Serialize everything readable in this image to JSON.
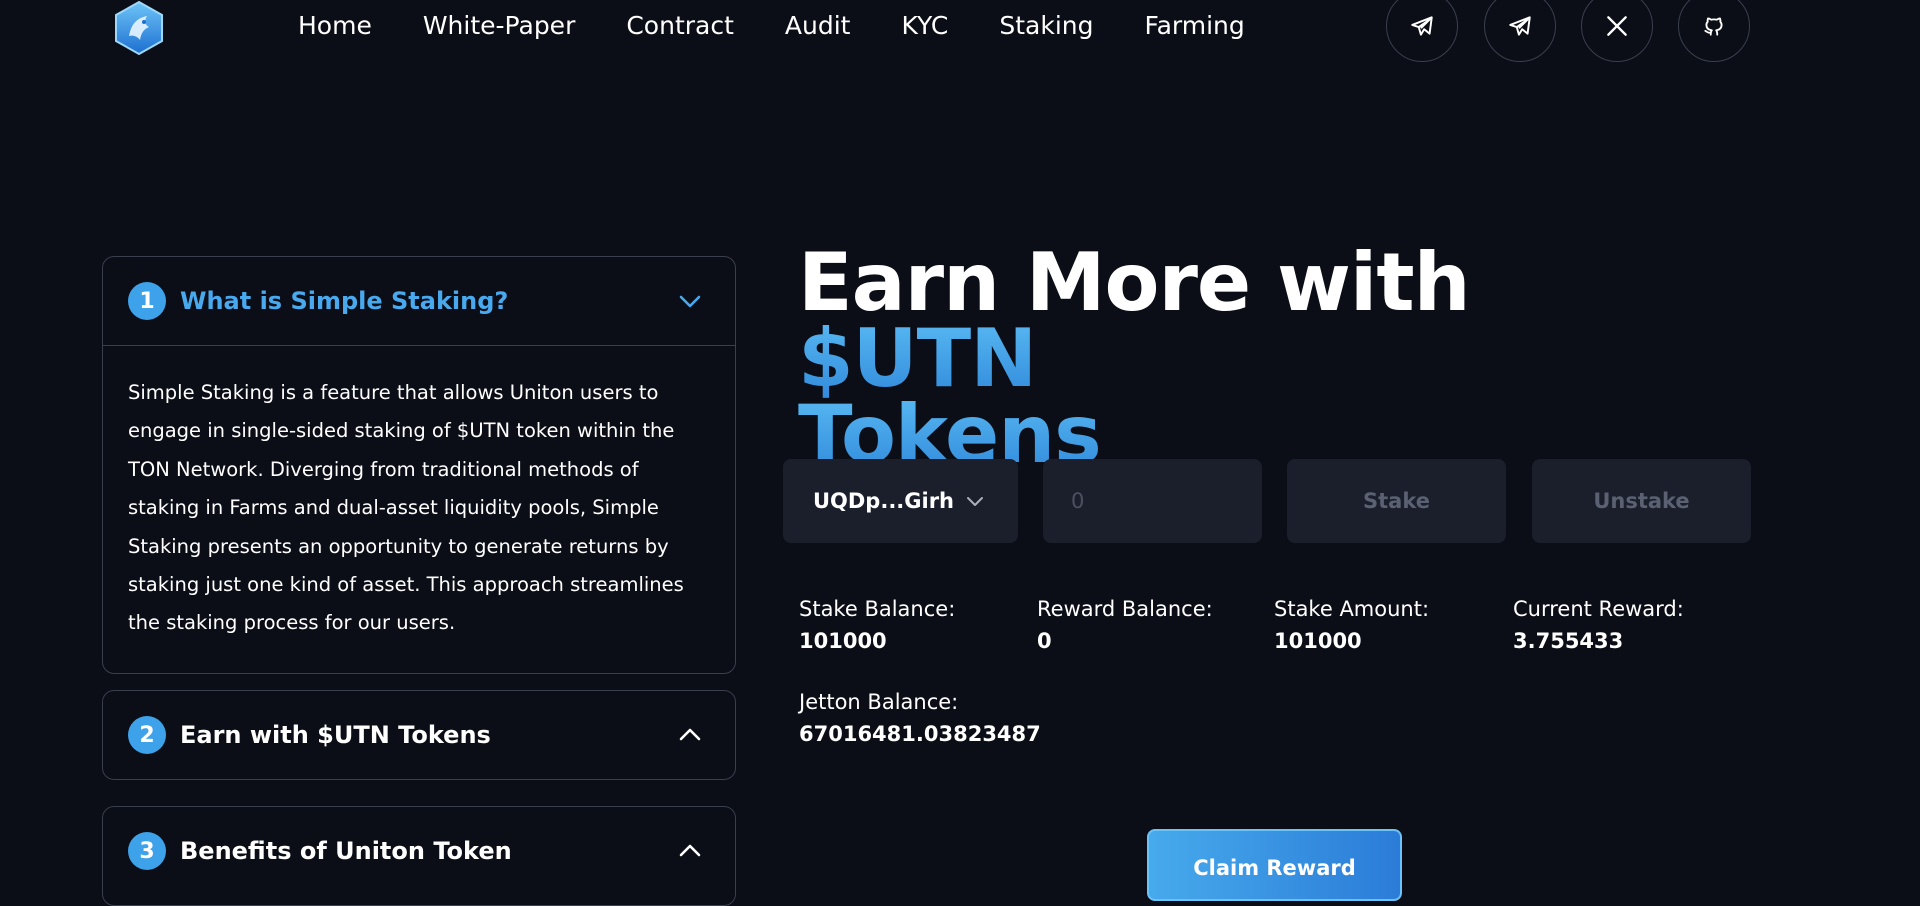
{
  "nav": {
    "logo_icon": "uniton-hexagon-logo",
    "links": [
      "Home",
      "White-Paper",
      "Contract",
      "Audit",
      "KYC",
      "Staking",
      "Farming"
    ],
    "socials": [
      "telegram-icon",
      "telegram-icon",
      "x-icon",
      "github-icon"
    ]
  },
  "faq": [
    {
      "number": "1",
      "title": "What is Simple Staking?",
      "expanded": true,
      "body": "Simple Staking is a feature that allows Uniton users to engage in single-sided staking of $UTN token within the TON Network. Diverging from traditional methods of staking in Farms and dual-asset liquidity pools, Simple Staking presents an opportunity to generate returns by staking just one kind of asset. This approach streamlines the staking process for our users."
    },
    {
      "number": "2",
      "title": "Earn with $UTN Tokens",
      "expanded": false
    },
    {
      "number": "3",
      "title": "Benefits of Uniton Token",
      "expanded": false
    }
  ],
  "hero": {
    "title_plain": "Earn More with ",
    "title_accent_1": "$UTN",
    "title_accent_2": "Tokens"
  },
  "staking": {
    "wallet_label": "UQDp...Girh",
    "amount_placeholder": "0",
    "stake_label": "Stake",
    "unstake_label": "Unstake",
    "stats": [
      {
        "label": "Stake Balance:",
        "value": "101000"
      },
      {
        "label": "Reward Balance:",
        "value": "0"
      },
      {
        "label": "Stake Amount:",
        "value": "101000"
      },
      {
        "label": "Current Reward:",
        "value": "3.755433"
      },
      {
        "label": "Jetton Balance:",
        "value": "67016481.03823487"
      }
    ],
    "claim_label": "Claim Reward"
  },
  "colors": {
    "background": "#0b0e17",
    "accent": "#3da2ea",
    "panel": "#1b1f2c",
    "border": "#3a3f4d"
  }
}
